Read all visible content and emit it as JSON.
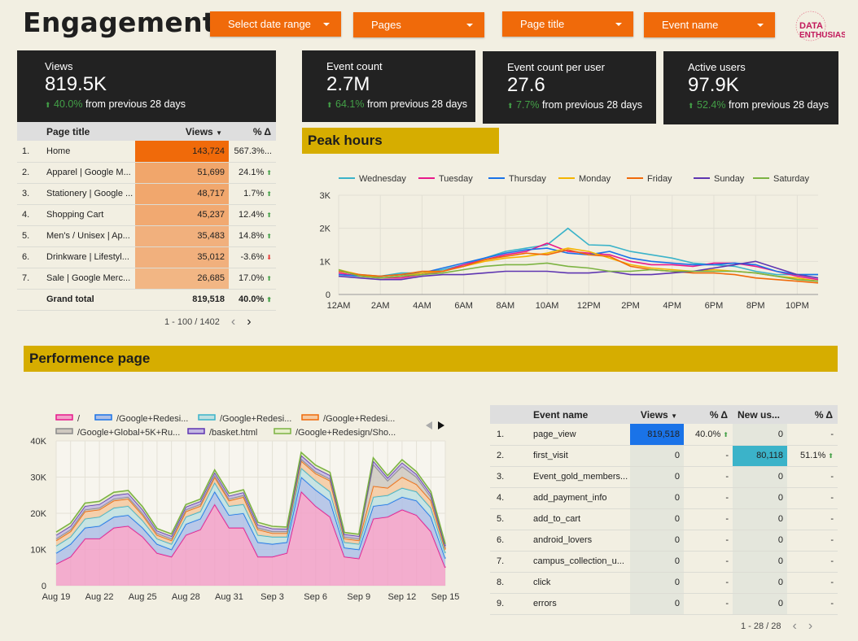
{
  "header": {
    "title": "Engagement",
    "filters": [
      "Select date range",
      "Pages",
      "Page title",
      "Event name"
    ],
    "logo_text_1": "DATA",
    "logo_text_2": "ENTHUSIAST"
  },
  "kpis": [
    {
      "label": "Views",
      "value": "819.5K",
      "pct": "40.0%",
      "suffix": "from previous 28 days"
    },
    {
      "label": "Event count",
      "value": "2.7M",
      "pct": "64.1%",
      "suffix": "from previous 28 days"
    },
    {
      "label": "Event count per user",
      "value": "27.6",
      "pct": "7.7%",
      "suffix": "from previous 28 days"
    },
    {
      "label": "Active users",
      "value": "97.9K",
      "pct": "52.4%",
      "suffix": "from previous 28 days"
    }
  ],
  "pages_table": {
    "headers": [
      "Page title",
      "Views",
      "% Δ"
    ],
    "rows": [
      {
        "idx": "1.",
        "title": "Home",
        "views": "143,724",
        "views_num": 143724,
        "delta": "567.3%...",
        "dir": ""
      },
      {
        "idx": "2.",
        "title": "Apparel | Google M...",
        "views": "51,699",
        "views_num": 51699,
        "delta": "24.1%",
        "dir": "up"
      },
      {
        "idx": "3.",
        "title": "Stationery | Google ...",
        "views": "48,717",
        "views_num": 48717,
        "delta": "1.7%",
        "dir": "up"
      },
      {
        "idx": "4.",
        "title": "Shopping Cart",
        "views": "45,237",
        "views_num": 45237,
        "delta": "12.4%",
        "dir": "up"
      },
      {
        "idx": "5.",
        "title": "Men's / Unisex | Ap...",
        "views": "35,483",
        "views_num": 35483,
        "delta": "14.8%",
        "dir": "up"
      },
      {
        "idx": "6.",
        "title": "Drinkware | Lifestyl...",
        "views": "35,012",
        "views_num": 35012,
        "delta": "-3.6%",
        "dir": "down"
      },
      {
        "idx": "7.",
        "title": "Sale | Google Merc...",
        "views": "26,685",
        "views_num": 26685,
        "delta": "17.0%",
        "dir": "up"
      }
    ],
    "total_label": "Grand total",
    "total_views": "819,518",
    "total_delta": "40.0%",
    "pager": "1 - 100 / 1402",
    "accent_color": "#f06a0a"
  },
  "peak_title": "Peak hours",
  "perf_title": "Performence page",
  "events_table": {
    "headers": [
      "Event name",
      "Views",
      "% Δ",
      "New us...",
      "% Δ"
    ],
    "rows": [
      {
        "idx": "1.",
        "name": "page_view",
        "views": "819,518",
        "vd": "40.0%",
        "vdir": "up",
        "users": "0",
        "ud": "-",
        "udir": ""
      },
      {
        "idx": "2.",
        "name": "first_visit",
        "views": "0",
        "vd": "-",
        "vdir": "",
        "users": "80,118",
        "ud": "51.1%",
        "udir": "up"
      },
      {
        "idx": "3.",
        "name": "Event_gold_members...",
        "views": "0",
        "vd": "-",
        "vdir": "",
        "users": "0",
        "ud": "-",
        "udir": ""
      },
      {
        "idx": "4.",
        "name": "add_payment_info",
        "views": "0",
        "vd": "-",
        "vdir": "",
        "users": "0",
        "ud": "-",
        "udir": ""
      },
      {
        "idx": "5.",
        "name": "add_to_cart",
        "views": "0",
        "vd": "-",
        "vdir": "",
        "users": "0",
        "ud": "-",
        "udir": ""
      },
      {
        "idx": "6.",
        "name": "android_lovers",
        "views": "0",
        "vd": "-",
        "vdir": "",
        "users": "0",
        "ud": "-",
        "udir": ""
      },
      {
        "idx": "7.",
        "name": "campus_collection_u...",
        "views": "0",
        "vd": "-",
        "vdir": "",
        "users": "0",
        "ud": "-",
        "udir": ""
      },
      {
        "idx": "8.",
        "name": "click",
        "views": "0",
        "vd": "-",
        "vdir": "",
        "users": "0",
        "ud": "-",
        "udir": ""
      },
      {
        "idx": "9.",
        "name": "errors",
        "views": "0",
        "vd": "-",
        "vdir": "",
        "users": "0",
        "ud": "-",
        "udir": ""
      }
    ],
    "pager": "1 - 28 / 28",
    "views_color": "#1a73e8",
    "users_color": "#3bb3c9"
  },
  "chart_data": [
    {
      "type": "line",
      "title": "Peak hours",
      "x": [
        "12AM",
        "1AM",
        "2AM",
        "3AM",
        "4AM",
        "5AM",
        "6AM",
        "7AM",
        "8AM",
        "9AM",
        "10AM",
        "11AM",
        "12PM",
        "1PM",
        "2PM",
        "3PM",
        "4PM",
        "5PM",
        "6PM",
        "7PM",
        "8PM",
        "9PM",
        "10PM",
        "11PM"
      ],
      "x_ticks": [
        "12AM",
        "2AM",
        "4AM",
        "6AM",
        "8AM",
        "10AM",
        "12PM",
        "2PM",
        "4PM",
        "6PM",
        "8PM",
        "10PM"
      ],
      "y_ticks": [
        "0",
        "1K",
        "2K",
        "3K"
      ],
      "ylim": [
        0,
        3000
      ],
      "grid": true,
      "legend": "top",
      "series": [
        {
          "name": "Wednesday",
          "color": "#3bb3c9",
          "values": [
            700,
            600,
            550,
            650,
            650,
            750,
            900,
            1100,
            1300,
            1400,
            1500,
            2000,
            1500,
            1480,
            1300,
            1200,
            1100,
            950,
            900,
            850,
            700,
            600,
            600,
            600
          ]
        },
        {
          "name": "Tuesday",
          "color": "#e8198b",
          "values": [
            650,
            550,
            500,
            500,
            600,
            700,
            900,
            1050,
            1200,
            1300,
            1550,
            1300,
            1250,
            1200,
            1000,
            900,
            900,
            850,
            950,
            950,
            850,
            700,
            550,
            450
          ]
        },
        {
          "name": "Thursday",
          "color": "#1a73e8",
          "values": [
            600,
            550,
            550,
            600,
            650,
            800,
            950,
            1100,
            1250,
            1350,
            1400,
            1250,
            1200,
            1300,
            1100,
            1000,
            950,
            900,
            900,
            950,
            900,
            700,
            600,
            600
          ]
        },
        {
          "name": "Monday",
          "color": "#f4b400",
          "values": [
            750,
            600,
            500,
            550,
            650,
            700,
            850,
            1000,
            1100,
            1150,
            1250,
            1400,
            1300,
            1100,
            900,
            800,
            750,
            700,
            750,
            700,
            650,
            550,
            500,
            400
          ]
        },
        {
          "name": "Friday",
          "color": "#f06a0a",
          "values": [
            700,
            600,
            550,
            600,
            700,
            700,
            850,
            1050,
            1150,
            1250,
            1200,
            1350,
            1200,
            1150,
            850,
            750,
            700,
            650,
            650,
            600,
            500,
            450,
            400,
            350
          ]
        },
        {
          "name": "Sunday",
          "color": "#5e35b1",
          "values": [
            550,
            500,
            450,
            450,
            550,
            600,
            600,
            650,
            700,
            700,
            700,
            650,
            650,
            700,
            600,
            600,
            650,
            700,
            800,
            900,
            1000,
            800,
            600,
            500
          ]
        },
        {
          "name": "Saturday",
          "color": "#7cb342",
          "values": [
            750,
            550,
            500,
            550,
            600,
            650,
            750,
            850,
            900,
            900,
            950,
            850,
            800,
            700,
            700,
            750,
            700,
            700,
            700,
            700,
            650,
            550,
            450,
            400
          ]
        }
      ]
    },
    {
      "type": "area",
      "title": "",
      "x": [
        "Aug 19",
        "Aug 20",
        "Aug 21",
        "Aug 22",
        "Aug 23",
        "Aug 24",
        "Aug 25",
        "Aug 26",
        "Aug 27",
        "Aug 28",
        "Aug 29",
        "Aug 30",
        "Aug 31",
        "Sep 1",
        "Sep 2",
        "Sep 3",
        "Sep 4",
        "Sep 5",
        "Sep 6",
        "Sep 7",
        "Sep 8",
        "Sep 9",
        "Sep 10",
        "Sep 11",
        "Sep 12",
        "Sep 13",
        "Sep 14",
        "Sep 15"
      ],
      "x_ticks": [
        "Aug 19",
        "Aug 22",
        "Aug 25",
        "Aug 28",
        "Aug 31",
        "Sep 3",
        "Sep 6",
        "Sep 9",
        "Sep 12",
        "Sep 15"
      ],
      "y_ticks": [
        "0",
        "10K",
        "20K",
        "30K",
        "40K"
      ],
      "ylim": [
        0,
        40000
      ],
      "stacked": true,
      "grid": true,
      "legend": "top",
      "series": [
        {
          "name": "/",
          "color": "#e8198b",
          "fill": "#f2a0c8",
          "values": [
            6000,
            8000,
            13000,
            13000,
            16000,
            16500,
            13500,
            9000,
            8000,
            14000,
            15500,
            22500,
            16000,
            16000,
            8000,
            8000,
            9000,
            26000,
            22000,
            19000,
            8000,
            7500,
            18500,
            19000,
            21000,
            19500,
            15000,
            5000
          ]
        },
        {
          "name": "/Google+Redesi...",
          "color": "#1a73e8",
          "fill": "#aebfe6",
          "values": [
            3000,
            3500,
            3000,
            3500,
            3000,
            3000,
            2500,
            2500,
            2000,
            3000,
            3000,
            3500,
            3500,
            4000,
            4000,
            3500,
            3000,
            4000,
            4500,
            4500,
            2500,
            2500,
            3500,
            3500,
            3500,
            4000,
            4000,
            2500
          ]
        },
        {
          "name": "/Google+Redesi...",
          "color": "#3bb3c9",
          "fill": "#bfe0e0",
          "values": [
            2000,
            2000,
            2500,
            2500,
            2500,
            2500,
            2000,
            1500,
            1500,
            2000,
            2000,
            2500,
            2500,
            2500,
            2000,
            2000,
            1500,
            2500,
            2500,
            2500,
            1500,
            1500,
            2500,
            2500,
            2500,
            2500,
            2500,
            1500
          ]
        },
        {
          "name": "/Google+Redesi...",
          "color": "#f06a0a",
          "fill": "#f5c9a0",
          "values": [
            1500,
            1500,
            2000,
            2000,
            2000,
            2000,
            1500,
            1000,
            1000,
            1500,
            1500,
            1500,
            1500,
            2000,
            1500,
            1000,
            1000,
            2000,
            2000,
            3000,
            1000,
            1000,
            3000,
            2000,
            3000,
            2000,
            2000,
            1000
          ]
        },
        {
          "name": "/Google+Global+5K+Ru...",
          "color": "#8a8a8a",
          "fill": "#cfc9c0",
          "values": [
            500,
            500,
            500,
            500,
            500,
            500,
            500,
            500,
            500,
            500,
            500,
            500,
            500,
            500,
            500,
            500,
            500,
            500,
            500,
            500,
            500,
            500,
            6000,
            2000,
            3000,
            2000,
            1000,
            500
          ]
        },
        {
          "name": "/basket.html",
          "color": "#5e35b1",
          "fill": "#c4b8e2",
          "values": [
            1000,
            1000,
            1000,
            1000,
            1000,
            1000,
            1000,
            700,
            700,
            800,
            800,
            800,
            800,
            800,
            800,
            800,
            700,
            1000,
            1000,
            1000,
            700,
            700,
            1000,
            800,
            1000,
            800,
            800,
            500
          ]
        },
        {
          "name": "/Google+Redesign/Sho...",
          "color": "#7cb342",
          "fill": "#e6eec9",
          "values": [
            800,
            800,
            800,
            800,
            800,
            800,
            800,
            600,
            600,
            600,
            600,
            700,
            700,
            700,
            700,
            600,
            500,
            800,
            800,
            800,
            500,
            500,
            800,
            600,
            800,
            700,
            700,
            500
          ]
        }
      ]
    }
  ]
}
